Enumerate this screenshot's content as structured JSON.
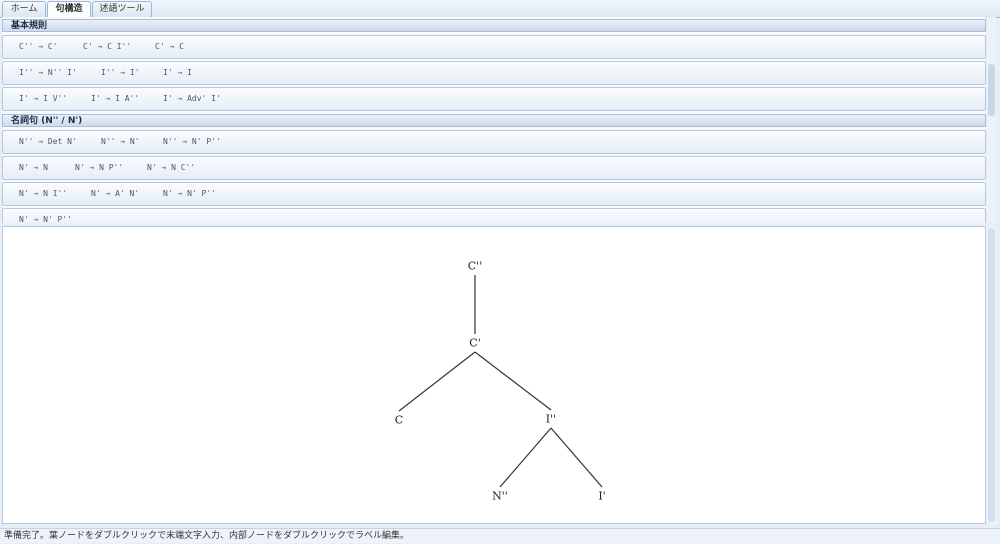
{
  "tabs": [
    {
      "label": "ホーム"
    },
    {
      "label": "句構造"
    },
    {
      "label": "述語ツール"
    }
  ],
  "rule_sections": [
    {
      "title": "基本規則",
      "rows": [
        [
          "C'' → C'",
          "C' → C I''",
          "C' → C"
        ],
        [
          "I'' → N'' I'",
          "I'' → I'",
          "I' → I"
        ],
        [
          "I' → I V''",
          "I' → I A''",
          "I' → Adv' I'"
        ]
      ]
    },
    {
      "title": "名詞句 (N'' / N')",
      "rows": [
        [
          "N'' → Det N'",
          "N'' → N'",
          "N'' → N' P''"
        ],
        [
          "N' → N",
          "N' → N P''",
          "N' → N C''"
        ],
        [
          "N' → N I''",
          "N' → A' N'",
          "N' → N' P''"
        ],
        [
          "N' → N' P''"
        ]
      ]
    }
  ],
  "tree": {
    "nodes": [
      {
        "id": "cpp",
        "label": "C''"
      },
      {
        "id": "cp",
        "label": "C'"
      },
      {
        "id": "c",
        "label": "C"
      },
      {
        "id": "ipp",
        "label": "I''"
      },
      {
        "id": "npp",
        "label": "N''"
      },
      {
        "id": "ip",
        "label": "I'"
      }
    ],
    "edges": [
      [
        "cpp",
        "cp"
      ],
      [
        "cp",
        "c"
      ],
      [
        "cp",
        "ipp"
      ],
      [
        "ipp",
        "npp"
      ],
      [
        "ipp",
        "ip"
      ]
    ]
  },
  "status": {
    "text": "準備完了。葉ノードをダブルクリックで末端文字入力、内部ノードをダブルクリックでラベル編集。"
  }
}
